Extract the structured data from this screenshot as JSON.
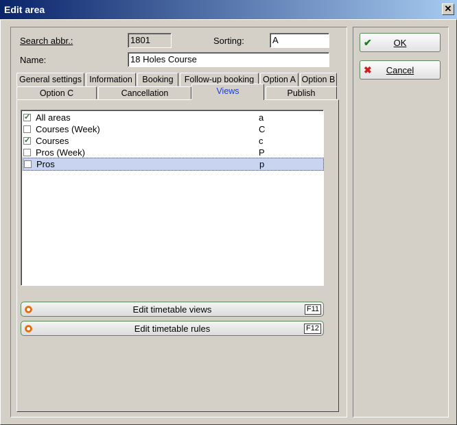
{
  "window": {
    "title": "Edit area",
    "close": "✕"
  },
  "form": {
    "search_label": "Search abbr.:",
    "search_value": "1801",
    "sorting_label": "Sorting:",
    "sorting_value": "A",
    "name_label": "Name:",
    "name_value": "18 Holes Course"
  },
  "tabs_row1": [
    "General settings",
    "Information",
    "Booking",
    "Follow-up booking",
    "Option A",
    "Option B"
  ],
  "tabs_row2": [
    "Option C",
    "Cancellation",
    "Views",
    "Publish"
  ],
  "active_tab": "Views",
  "views": [
    {
      "name": "All areas",
      "code": "a",
      "checked": true
    },
    {
      "name": "Courses (Week)",
      "code": "C",
      "checked": false
    },
    {
      "name": "Courses",
      "code": "c",
      "checked": true
    },
    {
      "name": "Pros (Week)",
      "code": "P",
      "checked": false
    },
    {
      "name": "Pros",
      "code": "p",
      "checked": false
    }
  ],
  "actions": {
    "edit_views": {
      "label": "Edit timetable views",
      "key": "F11"
    },
    "edit_rules": {
      "label": "Edit timetable rules",
      "key": "F12"
    }
  },
  "buttons": {
    "ok": "OK",
    "cancel": "Cancel"
  },
  "colors": {
    "titlebar_start": "#0a246a",
    "active_tab_text": "#1a3fd6",
    "ok_icon": "#1f7a1f",
    "cancel_icon": "#cc2020"
  },
  "icons": {
    "ok": "checkmark-icon",
    "cancel": "x-icon",
    "action": "orange-ring-icon",
    "checkbox": "checkbox-check-icon"
  }
}
